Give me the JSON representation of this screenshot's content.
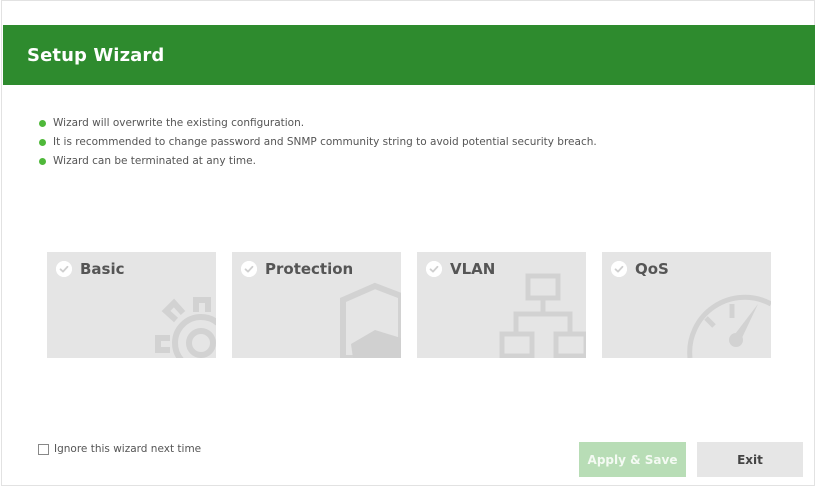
{
  "header": {
    "title": "Setup Wizard"
  },
  "notes": [
    "Wizard will overwrite the existing configuration.",
    "It is recommended to change password and SNMP community string to avoid potential security breach.",
    "Wizard can be terminated at any time."
  ],
  "cards": [
    {
      "label": "Basic",
      "icon": "gear-icon"
    },
    {
      "label": "Protection",
      "icon": "shield-icon"
    },
    {
      "label": "VLAN",
      "icon": "network-icon"
    },
    {
      "label": "QoS",
      "icon": "gauge-icon"
    }
  ],
  "footer": {
    "ignore_label": "Ignore this wizard next time",
    "ignore_checked": false,
    "apply_label": "Apply & Save",
    "exit_label": "Exit"
  },
  "colors": {
    "header_bg": "#2e8b2e",
    "bullet": "#4fb83a",
    "card_bg": "#e5e5e5",
    "apply_bg_disabled": "#b8ddb6"
  }
}
